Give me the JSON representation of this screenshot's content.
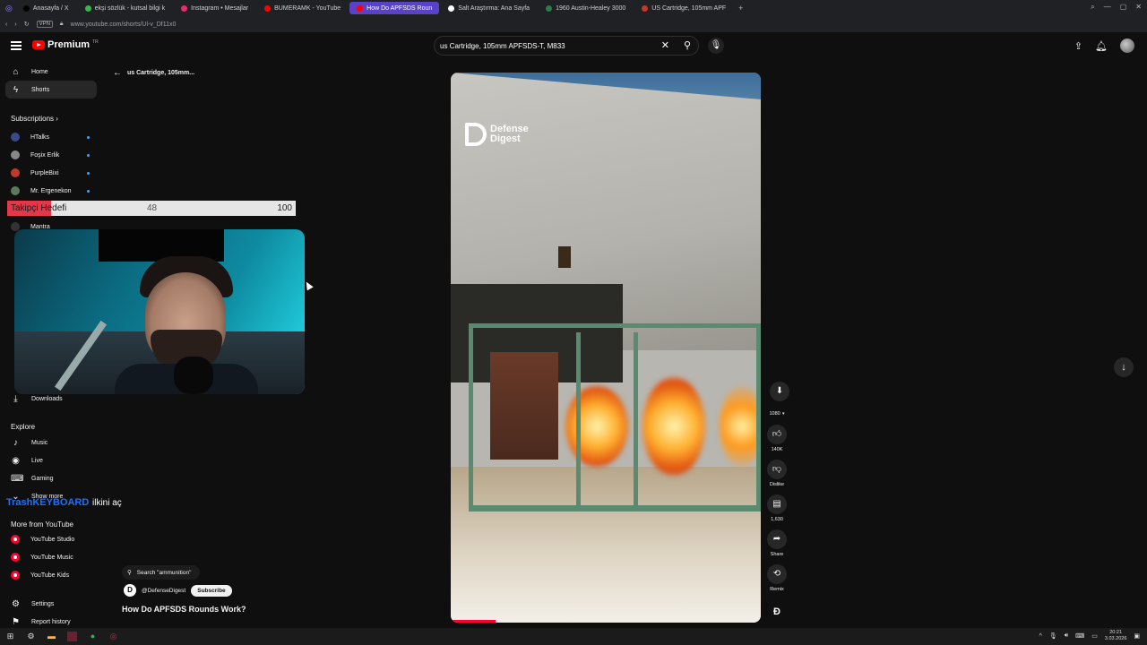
{
  "tabs": [
    {
      "label": "Anasayfa / X",
      "color": "#000000"
    },
    {
      "label": "ekşi sözlük - kutsal bilgi k",
      "color": "#3ab54a"
    },
    {
      "label": "Instagram • Mesajlar",
      "color": "#e1306c"
    },
    {
      "label": "BUMERAMK - YouTube",
      "color": "#ff0000"
    },
    {
      "label": "How Do APFSDS Roun",
      "color": "#ff0000"
    },
    {
      "label": "Salt Araştırma: Ana Sayfa",
      "color": "#ffffff"
    },
    {
      "label": "1960 Austin-Healey 3000",
      "color": "#2d7a4a"
    },
    {
      "label": "US Cartridge, 105mm APF",
      "color": "#c0392b"
    }
  ],
  "address": {
    "vpn": "VPN",
    "url": "www.youtube.com/shorts/Ul-v_Df11x0"
  },
  "header": {
    "premium": "Premium",
    "tm": "TR",
    "search_value": "us Cartridge, 105mm APFSDS-T, M833"
  },
  "sidebar": {
    "home": "Home",
    "shorts": "Shorts",
    "subscriptions": "Subscriptions",
    "channels": [
      {
        "name": "HTalks",
        "color": "#3a4a8a"
      },
      {
        "name": "Foşix Erlik",
        "color": "#888888"
      },
      {
        "name": "PurpleBixi",
        "color": "#c0392b"
      },
      {
        "name": "Mr. Ergenekon",
        "color": "#5a7a5a"
      },
      {
        "name": "Mantra",
        "color": "#333333"
      }
    ],
    "downloads": "Downloads",
    "explore": "Explore",
    "explore_items": [
      "Music",
      "Live",
      "Gaming"
    ],
    "show_more": "Show more",
    "more_from": "More from YouTube",
    "more_items": [
      "YouTube Studio",
      "YouTube Music",
      "YouTube Kids"
    ],
    "settings": "Settings",
    "report": "Report history"
  },
  "overlay": {
    "goal_label": "Takipçi Hedefi",
    "goal_current": "48",
    "goal_max": "100",
    "goal_fraction": 0.48,
    "trash": "TrashKEYBOARD",
    "ilk": "ilkini aç"
  },
  "short": {
    "back_title": "us Cartridge, 105mm...",
    "search_chip": "Search \"ammunition\"",
    "channel": "@DefenseDigest",
    "subscribe": "Subscribe",
    "title": "How Do APFSDS Rounds Work?",
    "watermark_line1": "Defense",
    "watermark_line2": "Digest"
  },
  "actions": {
    "quality": "1080",
    "likes": "140K",
    "dislike": "Dislike",
    "comments": "1,630",
    "share": "Share",
    "remix": "Remix"
  },
  "clock": {
    "time": "20:21",
    "date": "3.03.2026"
  }
}
